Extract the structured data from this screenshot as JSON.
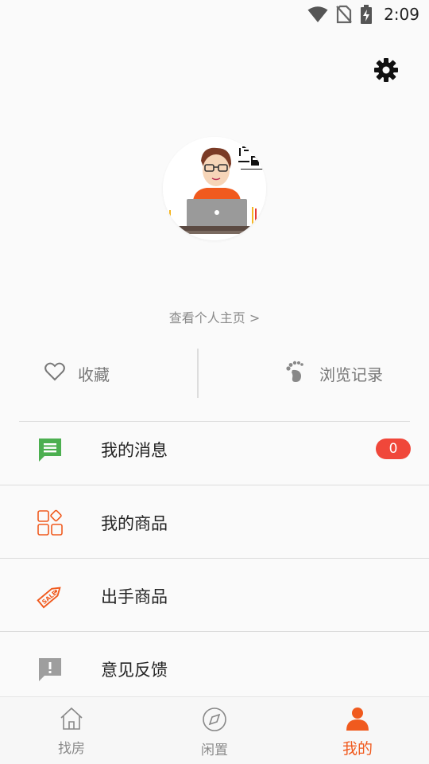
{
  "status_bar": {
    "time": "2:09",
    "icons": [
      "wifi-icon",
      "no-sim-icon",
      "battery-charging-icon"
    ]
  },
  "header": {
    "settings_icon": "gear-icon"
  },
  "profile": {
    "avatar": "avatar-illustration",
    "view_profile_label": "查看个人主页 >"
  },
  "shortcuts": {
    "favorites": {
      "label": "收藏",
      "icon": "heart-outline-icon"
    },
    "history": {
      "label": "浏览记录",
      "icon": "footprint-icon"
    }
  },
  "menu": {
    "items": [
      {
        "label": "我的消息",
        "icon": "message-icon",
        "badge": "0"
      },
      {
        "label": "我的商品",
        "icon": "grid-icon"
      },
      {
        "label": "出手商品",
        "icon": "sale-tag-icon"
      },
      {
        "label": "意见反馈",
        "icon": "feedback-icon"
      }
    ]
  },
  "bottom_nav": {
    "items": [
      {
        "label": "找房",
        "icon": "house-icon",
        "active": false
      },
      {
        "label": "闲置",
        "icon": "compass-icon",
        "active": false
      },
      {
        "label": "我的",
        "icon": "person-icon",
        "active": true
      }
    ]
  },
  "colors": {
    "accent": "#f05a1e",
    "badge": "#f0473a",
    "message_green": "#4caf50",
    "text_gray": "#8a8a8a"
  }
}
